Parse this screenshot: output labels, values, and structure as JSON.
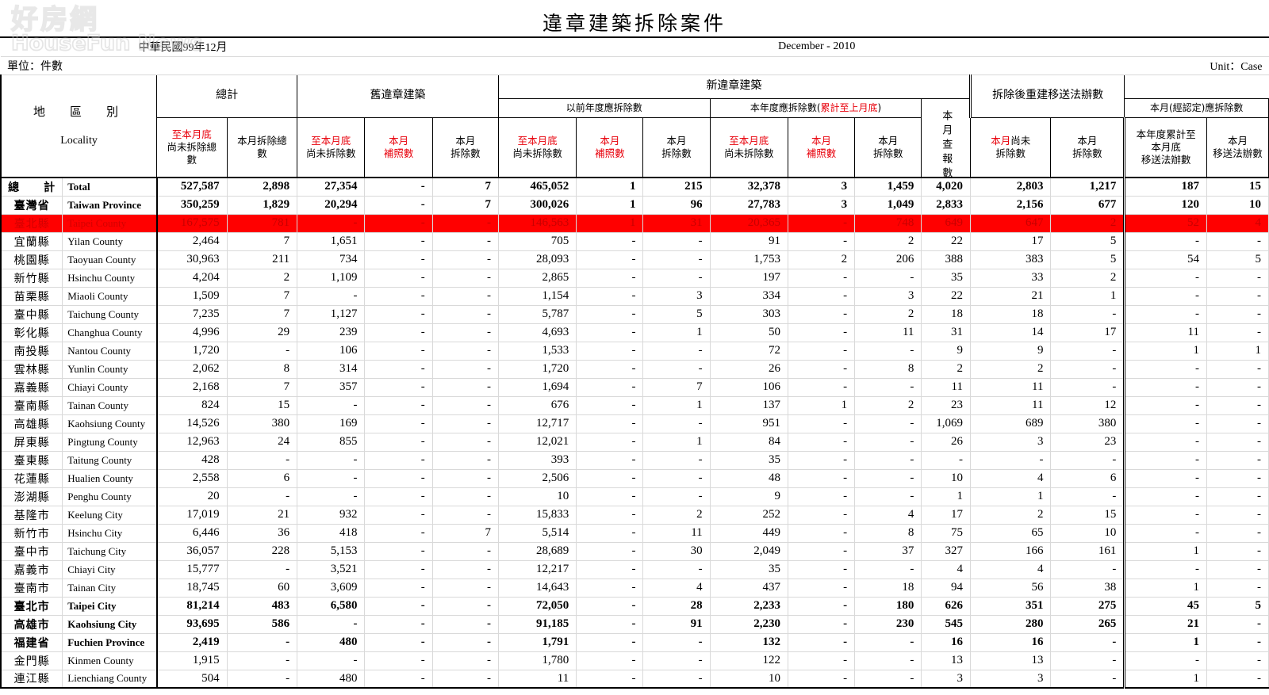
{
  "watermark": {
    "cn": "好房網",
    "en": "HouseFun News"
  },
  "title": "違章建築拆除案件",
  "date_roc": "中華民國99年12月",
  "date_en": "December - 2010",
  "unit_cn": "單位：件數",
  "unit_en": "Unit：Case",
  "locality": {
    "cn": "地　區　別",
    "en": "Locality"
  },
  "groups": {
    "total": "總計",
    "old": "舊違章建築",
    "new": "新違章建築",
    "prev_year": "以前年度應拆除數",
    "this_year": "本年度應拆除數(累計至上月底)",
    "this_month_confirmed": "本月(經認定)應拆除數",
    "rebuild": "拆除後重建移送法辦數"
  },
  "columns": [
    {
      "key": "c1",
      "l1": "至本月底",
      "l2": "尚未拆除總",
      "l3": "數",
      "red": true,
      "group": "total"
    },
    {
      "key": "c2",
      "l1": "本月拆除總",
      "l2": "數",
      "l3": "",
      "red": false,
      "group": "total"
    },
    {
      "key": "c3",
      "l1": "至本月底",
      "l2": "尚未拆除數",
      "l3": "",
      "red": true,
      "group": "old"
    },
    {
      "key": "c4",
      "l1": "本月",
      "l2": "補照數",
      "l3": "",
      "red": true,
      "group": "old"
    },
    {
      "key": "c5",
      "l1": "本月",
      "l2": "拆除數",
      "l3": "",
      "red": false,
      "group": "old"
    },
    {
      "key": "c6",
      "l1": "至本月底",
      "l2": "尚未拆除數",
      "l3": "",
      "red": true,
      "group": "prev_year"
    },
    {
      "key": "c7",
      "l1": "本月",
      "l2": "補照數",
      "l3": "",
      "red": true,
      "group": "prev_year"
    },
    {
      "key": "c8",
      "l1": "本月",
      "l2": "拆除數",
      "l3": "",
      "red": false,
      "group": "prev_year"
    },
    {
      "key": "c9",
      "l1": "至本月底",
      "l2": "尚未拆除數",
      "l3": "",
      "red": true,
      "group": "this_year"
    },
    {
      "key": "c10",
      "l1": "本月",
      "l2": "補照數",
      "l3": "",
      "red": true,
      "group": "this_year"
    },
    {
      "key": "c11",
      "l1": "本月",
      "l2": "拆除數",
      "l3": "",
      "red": false,
      "group": "this_year"
    },
    {
      "key": "c12",
      "l1": "本月查報數",
      "l2": "",
      "l3": "",
      "red": false,
      "group": "new",
      "vertical": true
    },
    {
      "key": "c13",
      "l1": "本月尚未",
      "l2": "拆除數",
      "l3": "",
      "red": "partial",
      "group": "this_month_confirmed"
    },
    {
      "key": "c14",
      "l1": "本月",
      "l2": "拆除數",
      "l3": "",
      "red": false,
      "group": "this_month_confirmed"
    },
    {
      "key": "c15",
      "l1": "本年度累計至",
      "l2": "本月底",
      "l3": "移送法辦數",
      "red": false,
      "group": "rebuild"
    },
    {
      "key": "c16",
      "l1": "本月",
      "l2": "移送法辦數",
      "l3": "",
      "red": false,
      "group": "rebuild"
    }
  ],
  "rows": [
    {
      "cn": "總　　計",
      "en": "Total",
      "style": "bold",
      "values": [
        "527,587",
        "2,898",
        "27,354",
        "-",
        "7",
        "465,052",
        "1",
        "215",
        "32,378",
        "3",
        "1,459",
        "4,020",
        "2,803",
        "1,217",
        "187",
        "15"
      ]
    },
    {
      "cn": "臺灣省",
      "en": "Taiwan Province",
      "style": "bold",
      "values": [
        "350,259",
        "1,829",
        "20,294",
        "-",
        "7",
        "300,026",
        "1",
        "96",
        "27,783",
        "3",
        "1,049",
        "2,833",
        "2,156",
        "677",
        "120",
        "10"
      ]
    },
    {
      "cn": "臺北縣",
      "en": "Taipei County",
      "style": "highlight",
      "values": [
        "167,575",
        "781",
        "-",
        "-",
        "-",
        "146,563",
        "1",
        "31",
        "20,365",
        "-",
        "748",
        "649",
        "647",
        "2",
        "52",
        "4"
      ]
    },
    {
      "cn": "宜蘭縣",
      "en": "Yilan County",
      "style": "",
      "values": [
        "2,464",
        "7",
        "1,651",
        "-",
        "-",
        "705",
        "-",
        "-",
        "91",
        "-",
        "2",
        "22",
        "17",
        "5",
        "-",
        "-"
      ]
    },
    {
      "cn": "桃園縣",
      "en": "Taoyuan County",
      "style": "",
      "values": [
        "30,963",
        "211",
        "734",
        "-",
        "-",
        "28,093",
        "-",
        "-",
        "1,753",
        "2",
        "206",
        "388",
        "383",
        "5",
        "54",
        "5"
      ]
    },
    {
      "cn": "新竹縣",
      "en": "Hsinchu County",
      "style": "",
      "values": [
        "4,204",
        "2",
        "1,109",
        "-",
        "-",
        "2,865",
        "-",
        "-",
        "197",
        "-",
        "-",
        "35",
        "33",
        "2",
        "-",
        "-"
      ]
    },
    {
      "cn": "苗栗縣",
      "en": "Miaoli County",
      "style": "",
      "values": [
        "1,509",
        "7",
        "-",
        "-",
        "-",
        "1,154",
        "-",
        "3",
        "334",
        "-",
        "3",
        "22",
        "21",
        "1",
        "-",
        "-"
      ]
    },
    {
      "cn": "臺中縣",
      "en": "Taichung County",
      "style": "",
      "values": [
        "7,235",
        "7",
        "1,127",
        "-",
        "-",
        "5,787",
        "-",
        "5",
        "303",
        "-",
        "2",
        "18",
        "18",
        "-",
        "-",
        "-"
      ]
    },
    {
      "cn": "彰化縣",
      "en": "Changhua County",
      "style": "",
      "values": [
        "4,996",
        "29",
        "239",
        "-",
        "-",
        "4,693",
        "-",
        "1",
        "50",
        "-",
        "11",
        "31",
        "14",
        "17",
        "11",
        "-"
      ]
    },
    {
      "cn": "南投縣",
      "en": "Nantou County",
      "style": "",
      "values": [
        "1,720",
        "-",
        "106",
        "-",
        "-",
        "1,533",
        "-",
        "-",
        "72",
        "-",
        "-",
        "9",
        "9",
        "-",
        "1",
        "1"
      ]
    },
    {
      "cn": "雲林縣",
      "en": "Yunlin County",
      "style": "",
      "values": [
        "2,062",
        "8",
        "314",
        "-",
        "-",
        "1,720",
        "-",
        "-",
        "26",
        "-",
        "8",
        "2",
        "2",
        "-",
        "-",
        "-"
      ]
    },
    {
      "cn": "嘉義縣",
      "en": "Chiayi County",
      "style": "",
      "values": [
        "2,168",
        "7",
        "357",
        "-",
        "-",
        "1,694",
        "-",
        "7",
        "106",
        "-",
        "-",
        "11",
        "11",
        "-",
        "-",
        "-"
      ]
    },
    {
      "cn": "臺南縣",
      "en": "Tainan County",
      "style": "",
      "values": [
        "824",
        "15",
        "-",
        "-",
        "-",
        "676",
        "-",
        "1",
        "137",
        "1",
        "2",
        "23",
        "11",
        "12",
        "-",
        "-"
      ]
    },
    {
      "cn": "高雄縣",
      "en": "Kaohsiung County",
      "style": "",
      "values": [
        "14,526",
        "380",
        "169",
        "-",
        "-",
        "12,717",
        "-",
        "-",
        "951",
        "-",
        "-",
        "1,069",
        "689",
        "380",
        "-",
        "-"
      ]
    },
    {
      "cn": "屏東縣",
      "en": "Pingtung County",
      "style": "",
      "values": [
        "12,963",
        "24",
        "855",
        "-",
        "-",
        "12,021",
        "-",
        "1",
        "84",
        "-",
        "-",
        "26",
        "3",
        "23",
        "-",
        "-"
      ]
    },
    {
      "cn": "臺東縣",
      "en": "Taitung County",
      "style": "",
      "values": [
        "428",
        "-",
        "-",
        "-",
        "-",
        "393",
        "-",
        "-",
        "35",
        "-",
        "-",
        "-",
        "-",
        "-",
        "-",
        "-"
      ]
    },
    {
      "cn": "花蓮縣",
      "en": "Hualien County",
      "style": "",
      "values": [
        "2,558",
        "6",
        "-",
        "-",
        "-",
        "2,506",
        "-",
        "-",
        "48",
        "-",
        "-",
        "10",
        "4",
        "6",
        "-",
        "-"
      ]
    },
    {
      "cn": "澎湖縣",
      "en": "Penghu County",
      "style": "",
      "values": [
        "20",
        "-",
        "-",
        "-",
        "-",
        "10",
        "-",
        "-",
        "9",
        "-",
        "-",
        "1",
        "1",
        "-",
        "-",
        "-"
      ]
    },
    {
      "cn": "基隆市",
      "en": "Keelung City",
      "style": "",
      "values": [
        "17,019",
        "21",
        "932",
        "-",
        "-",
        "15,833",
        "-",
        "2",
        "252",
        "-",
        "4",
        "17",
        "2",
        "15",
        "-",
        "-"
      ]
    },
    {
      "cn": "新竹市",
      "en": "Hsinchu City",
      "style": "",
      "values": [
        "6,446",
        "36",
        "418",
        "-",
        "7",
        "5,514",
        "-",
        "11",
        "449",
        "-",
        "8",
        "75",
        "65",
        "10",
        "-",
        "-"
      ]
    },
    {
      "cn": "臺中市",
      "en": "Taichung City",
      "style": "",
      "values": [
        "36,057",
        "228",
        "5,153",
        "-",
        "-",
        "28,689",
        "-",
        "30",
        "2,049",
        "-",
        "37",
        "327",
        "166",
        "161",
        "1",
        "-"
      ]
    },
    {
      "cn": "嘉義市",
      "en": "Chiayi City",
      "style": "",
      "values": [
        "15,777",
        "-",
        "3,521",
        "-",
        "-",
        "12,217",
        "-",
        "-",
        "35",
        "-",
        "-",
        "4",
        "4",
        "-",
        "-",
        "-"
      ]
    },
    {
      "cn": "臺南市",
      "en": "Tainan City",
      "style": "",
      "values": [
        "18,745",
        "60",
        "3,609",
        "-",
        "-",
        "14,643",
        "-",
        "4",
        "437",
        "-",
        "18",
        "94",
        "56",
        "38",
        "1",
        "-"
      ]
    },
    {
      "cn": "臺北市",
      "en": "Taipei City",
      "style": "bold",
      "values": [
        "81,214",
        "483",
        "6,580",
        "-",
        "-",
        "72,050",
        "-",
        "28",
        "2,233",
        "-",
        "180",
        "626",
        "351",
        "275",
        "45",
        "5"
      ]
    },
    {
      "cn": "高雄市",
      "en": "Kaohsiung City",
      "style": "bold",
      "values": [
        "93,695",
        "586",
        "-",
        "-",
        "-",
        "91,185",
        "-",
        "91",
        "2,230",
        "-",
        "230",
        "545",
        "280",
        "265",
        "21",
        "-"
      ]
    },
    {
      "cn": "福建省",
      "en": "Fuchien Province",
      "style": "bold",
      "values": [
        "2,419",
        "-",
        "480",
        "-",
        "-",
        "1,791",
        "-",
        "-",
        "132",
        "-",
        "-",
        "16",
        "16",
        "-",
        "1",
        "-"
      ]
    },
    {
      "cn": "金門縣",
      "en": "Kinmen County",
      "style": "",
      "values": [
        "1,915",
        "-",
        "-",
        "-",
        "-",
        "1,780",
        "-",
        "-",
        "122",
        "-",
        "-",
        "13",
        "13",
        "-",
        "-",
        "-"
      ]
    },
    {
      "cn": "連江縣",
      "en": "Lienchiang County",
      "style": "",
      "values": [
        "504",
        "-",
        "480",
        "-",
        "-",
        "11",
        "-",
        "-",
        "10",
        "-",
        "-",
        "3",
        "3",
        "-",
        "1",
        "-"
      ]
    }
  ]
}
